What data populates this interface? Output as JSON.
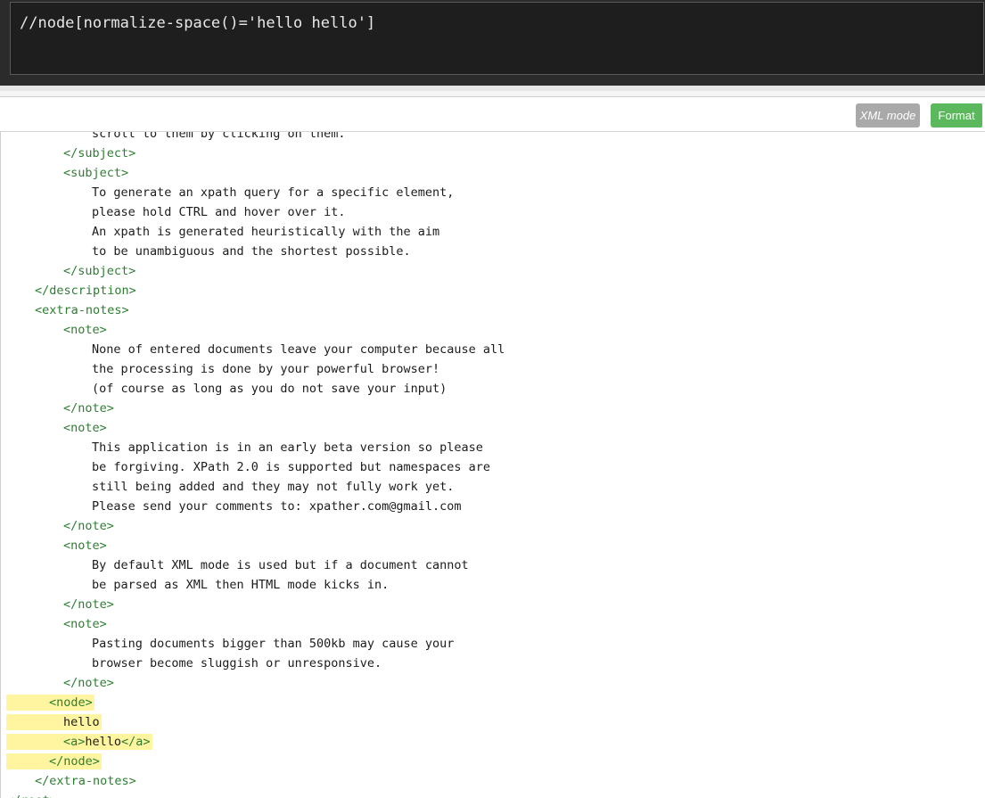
{
  "query": {
    "value": "//node[normalize-space()='hello hello']"
  },
  "toolbar": {
    "xml_mode_label": "XML mode",
    "format_label": "Format"
  },
  "colors": {
    "tag": "#2e7d32",
    "highlight": "#fff5a0",
    "format_button": "#5cb85c",
    "xml_mode_button": "#a9a9a9"
  },
  "editor": {
    "lines": [
      {
        "indent": 12,
        "kind": "text",
        "text": "scroll to them by clicking on them."
      },
      {
        "indent": 8,
        "kind": "tag",
        "text": "</subject>"
      },
      {
        "indent": 8,
        "kind": "tag",
        "text": "<subject>"
      },
      {
        "indent": 12,
        "kind": "text",
        "text": "To generate an xpath query for a specific element,"
      },
      {
        "indent": 12,
        "kind": "text",
        "text": "please hold CTRL and hover over it."
      },
      {
        "indent": 12,
        "kind": "text",
        "text": "An xpath is generated heuristically with the aim"
      },
      {
        "indent": 12,
        "kind": "text",
        "text": "to be unambiguous and the shortest possible."
      },
      {
        "indent": 8,
        "kind": "tag",
        "text": "</subject>"
      },
      {
        "indent": 4,
        "kind": "tag",
        "text": "</description>"
      },
      {
        "indent": 4,
        "kind": "tag",
        "text": "<extra-notes>"
      },
      {
        "indent": 8,
        "kind": "tag",
        "text": "<note>"
      },
      {
        "indent": 12,
        "kind": "text",
        "text": "None of entered documents leave your computer because all"
      },
      {
        "indent": 12,
        "kind": "text",
        "text": "the processing is done by your powerful browser!"
      },
      {
        "indent": 12,
        "kind": "text",
        "text": "(of course as long as you do not save your input)"
      },
      {
        "indent": 8,
        "kind": "tag",
        "text": "</note>"
      },
      {
        "indent": 8,
        "kind": "tag",
        "text": "<note>"
      },
      {
        "indent": 12,
        "kind": "text",
        "text": "This application is in an early beta version so please"
      },
      {
        "indent": 12,
        "kind": "text",
        "text": "be forgiving. XPath 2.0 is supported but namespaces are"
      },
      {
        "indent": 12,
        "kind": "text",
        "text": "still being added and they may not fully work yet."
      },
      {
        "indent": 12,
        "kind": "text",
        "text": "Please send your comments to: xpather.com@gmail.com"
      },
      {
        "indent": 8,
        "kind": "tag",
        "text": "</note>"
      },
      {
        "indent": 8,
        "kind": "tag",
        "text": "<note>"
      },
      {
        "indent": 12,
        "kind": "text",
        "text": "By default XML mode is used but if a document cannot"
      },
      {
        "indent": 12,
        "kind": "text",
        "text": "be parsed as XML then HTML mode kicks in."
      },
      {
        "indent": 8,
        "kind": "tag",
        "text": "</note>"
      },
      {
        "indent": 8,
        "kind": "tag",
        "text": "<note>"
      },
      {
        "indent": 12,
        "kind": "text",
        "text": "Pasting documents bigger than 500kb may cause your"
      },
      {
        "indent": 12,
        "kind": "text",
        "text": "browser become sluggish or unresponsive."
      },
      {
        "indent": 8,
        "kind": "tag",
        "text": "</note>"
      },
      {
        "indent": 6,
        "kind": "tag",
        "text": "<node>",
        "highlight": true
      },
      {
        "indent": 8,
        "kind": "text",
        "text": "hello",
        "highlight": true
      },
      {
        "indent": 8,
        "kind": "mixed",
        "parts": [
          [
            "tag",
            "<a>"
          ],
          [
            "text",
            "hello"
          ],
          [
            "tag",
            "</a>"
          ]
        ],
        "highlight": true
      },
      {
        "indent": 6,
        "kind": "tag",
        "text": "</node>",
        "highlight": true
      },
      {
        "indent": 4,
        "kind": "tag",
        "text": "</extra-notes>"
      },
      {
        "indent": 0,
        "kind": "tag",
        "text": "</root>"
      }
    ]
  }
}
